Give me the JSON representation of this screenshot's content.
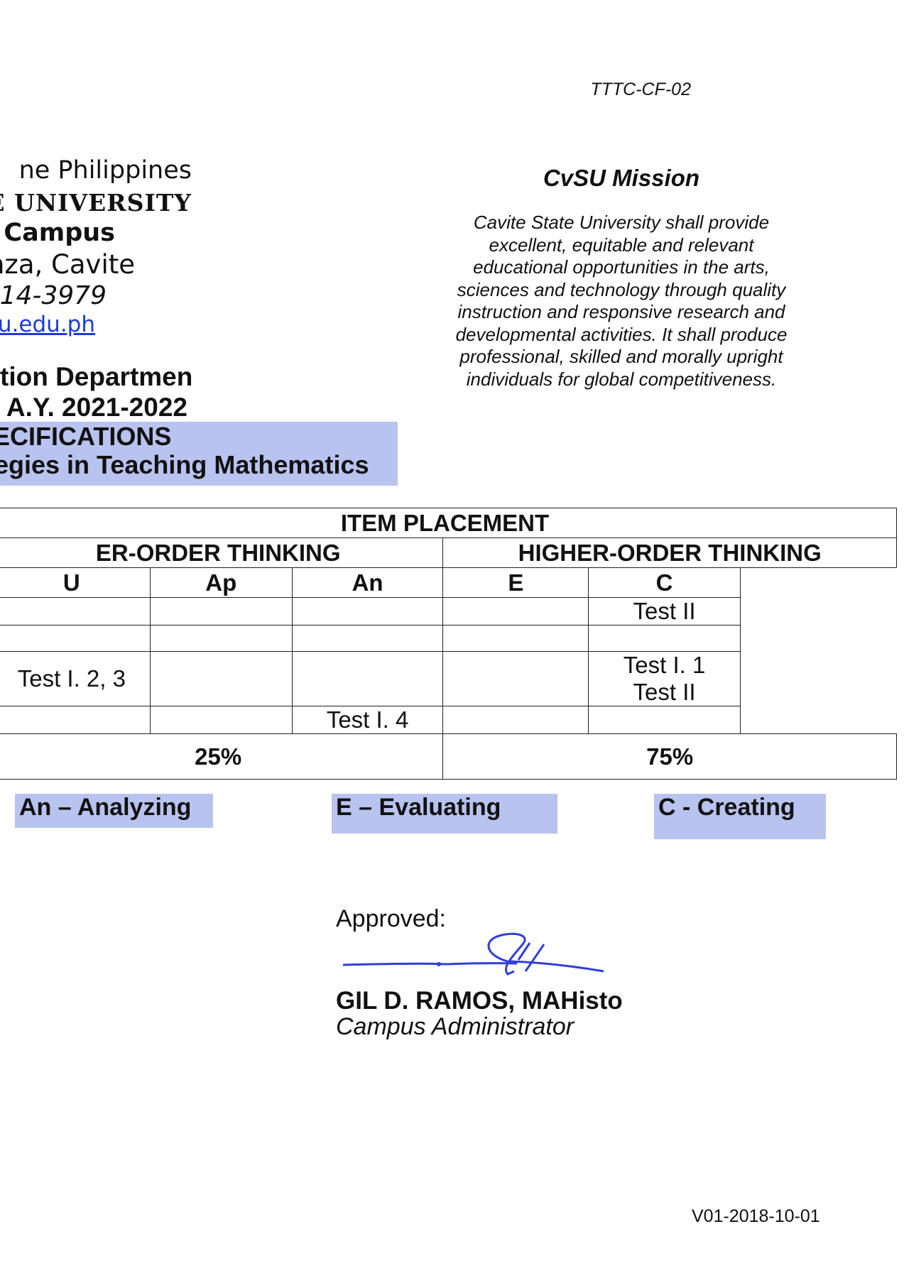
{
  "form_code": "TTTC-CF-02",
  "version": "V01-2018-10-01",
  "university_header": {
    "line1": "ne Philippines",
    "line2": "E UNIVERSITY",
    "line3": "Campus",
    "line4": "nza, Cavite",
    "line5": "414-3979",
    "line6": "u.edu.ph"
  },
  "mission": {
    "title": "CvSU Mission",
    "body": "Cavite State University shall provide excellent, equitable and relevant educational opportunities in the arts, sciences and technology through quality instruction and responsive research and developmental activities. It shall produce professional, skilled and morally upright individuals for global competitiveness."
  },
  "department": "tion Department",
  "academic_year": "A.Y. 2021-2022",
  "spec_title": "ECIFICATIONS",
  "course_title": "egies in Teaching Mathematics",
  "table": {
    "header": "ITEM PLACEMENT",
    "lower_order": "ER-ORDER THINKING",
    "higher_order": "HIGHER-ORDER THINKING",
    "col_u": "U",
    "col_ap": "Ap",
    "col_an": "An",
    "col_e": "E",
    "col_c": "C",
    "rows": [
      {
        "u": "",
        "ap": "",
        "an": "",
        "e": "",
        "c": "Test II"
      },
      {
        "u": "",
        "ap": "",
        "an": "",
        "e": "",
        "c": ""
      },
      {
        "u": "Test I. 2, 3",
        "ap": "",
        "an": "",
        "e": "",
        "c": "Test I. 1",
        "c2": "Test II"
      },
      {
        "u": "",
        "ap": "",
        "an": "Test I. 4",
        "e": "",
        "c": ""
      }
    ],
    "lower_pct": "25%",
    "higher_pct": "75%"
  },
  "legend": {
    "an": "An – Analyzing",
    "e": "E – Evaluating",
    "c": "C - Creating"
  },
  "approval": {
    "label": "Approved:",
    "name": "GIL D. RAMOS, MAHisto",
    "role": "Campus Administrator"
  },
  "colors": {
    "highlight": "#b9c3ef",
    "signature_ink": "#2f3fd8",
    "link": "#1a3cd6"
  }
}
